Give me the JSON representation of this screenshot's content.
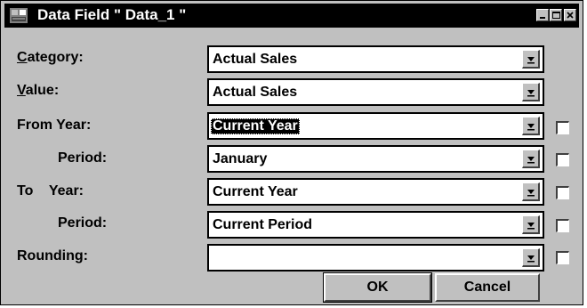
{
  "window": {
    "title": "Data Field \" Data_1 \""
  },
  "fields": {
    "category": {
      "label_ul": "C",
      "label_rest": "ategory:",
      "value": "Actual Sales"
    },
    "value": {
      "label_ul": "V",
      "label_rest": "alue:",
      "value": "Actual Sales"
    },
    "from_year": {
      "label": "From Year:",
      "value": "Current Year"
    },
    "from_period": {
      "label": "Period:",
      "value": "January"
    },
    "to_year": {
      "label": "To    Year:",
      "value": "Current Year"
    },
    "to_period": {
      "label": "Period:",
      "value": "Current Period"
    },
    "rounding": {
      "label": "Rounding:",
      "value": ""
    }
  },
  "buttons": {
    "ok": "OK",
    "cancel": "Cancel"
  },
  "icons": {
    "window": "data-field-icon",
    "minimize": "minimize-icon",
    "maximize": "maximize-icon",
    "close": "close-icon",
    "dropdown": "chevron-down-icon"
  }
}
